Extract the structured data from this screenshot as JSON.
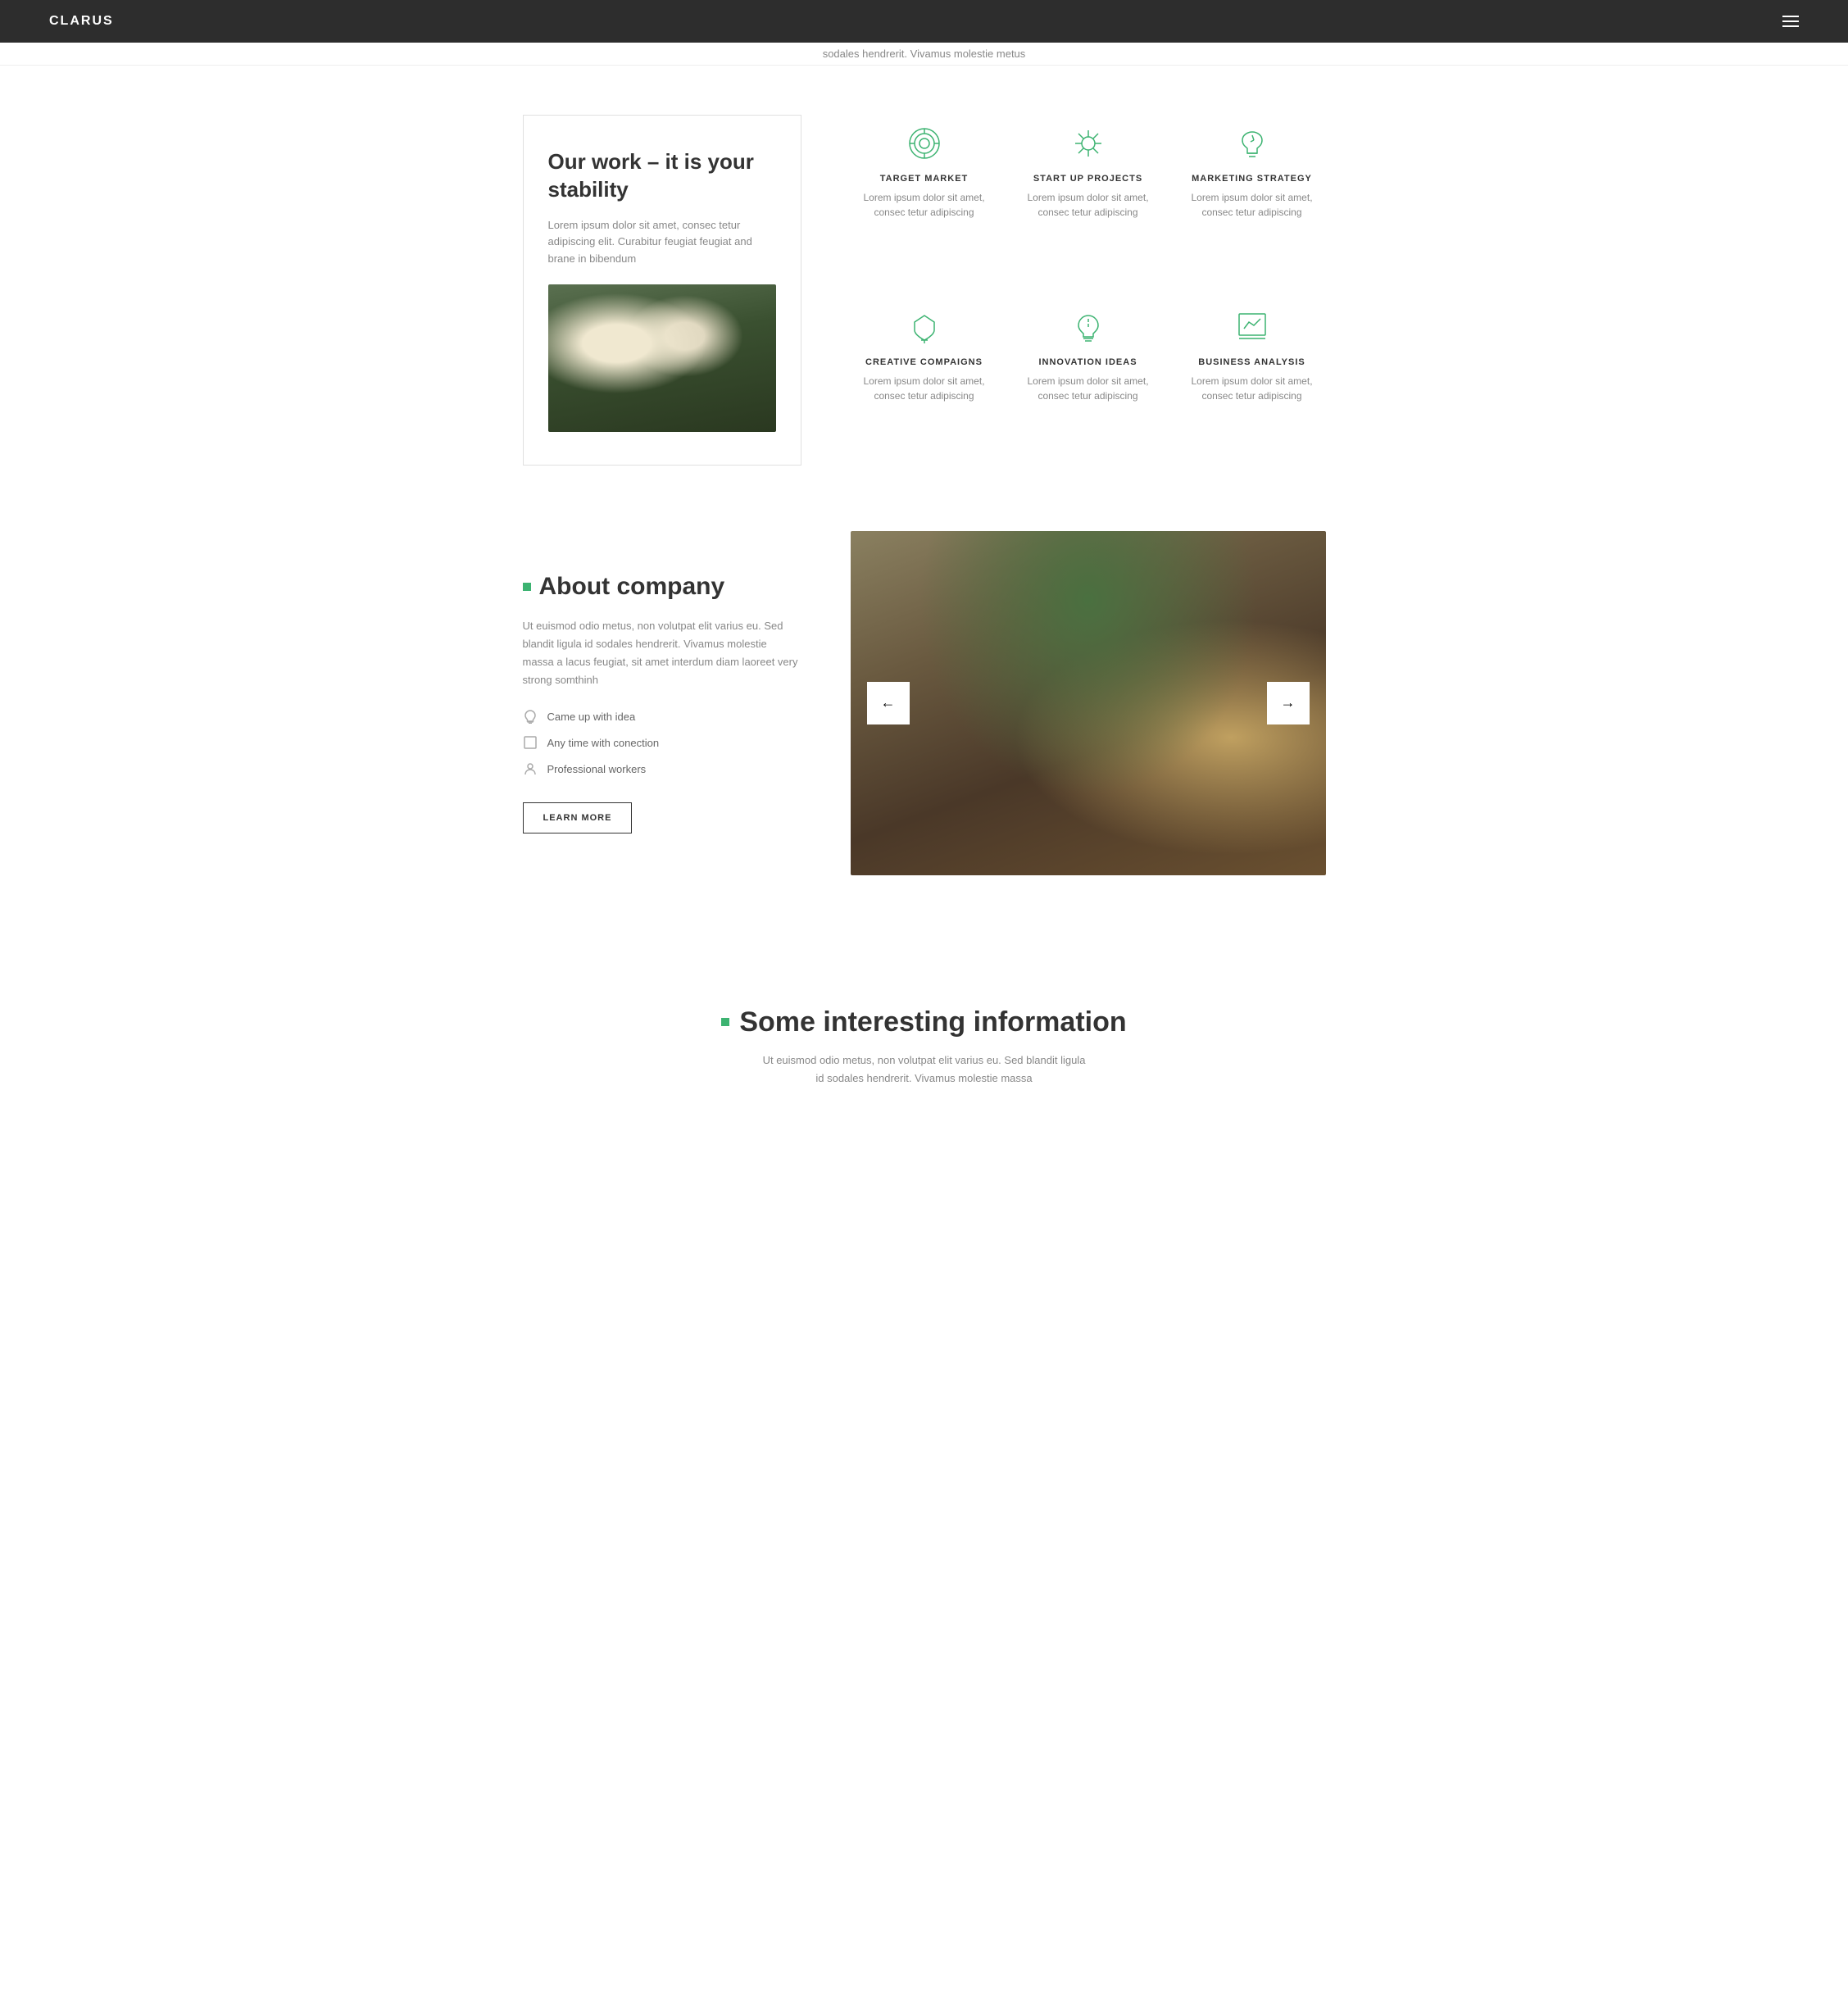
{
  "nav": {
    "logo": "CLARUS",
    "menu_icon_label": "menu"
  },
  "top_text": "sodales hendrerit. Vivamus molestie metus",
  "section_work": {
    "title": "Our work – it is your stability",
    "description": "Lorem ipsum dolor sit amet, consec tetur adipiscing elit. Curabitur feugiat feugiat and brane in bibendum",
    "features": [
      {
        "id": "target-market",
        "title": "TARGET MARKET",
        "description": "Lorem ipsum dolor sit amet, consec tetur adipiscing",
        "icon": "target"
      },
      {
        "id": "startup-projects",
        "title": "START UP PROJECTS",
        "description": "Lorem ipsum dolor sit amet, consec tetur adipiscing",
        "icon": "telescope"
      },
      {
        "id": "marketing-strategy",
        "title": "MARKETING STRATEGY",
        "description": "Lorem ipsum dolor sit amet, consec tetur adipiscing",
        "icon": "horse"
      },
      {
        "id": "creative-campaigns",
        "title": "CREATIVE COMPAIGNS",
        "description": "Lorem ipsum dolor sit amet, consec tetur adipiscing",
        "icon": "trophy"
      },
      {
        "id": "innovation-ideas",
        "title": "INNOVATION IDEAS",
        "description": "Lorem ipsum dolor sit amet, consec tetur adipiscing",
        "icon": "bulb"
      },
      {
        "id": "business-analysis",
        "title": "BUSINESS ANALYSIS",
        "description": "Lorem ipsum dolor sit amet, consec tetur adipiscing",
        "icon": "chart"
      }
    ]
  },
  "section_about": {
    "title": "About company",
    "description": "Ut euismod odio metus, non volutpat elit varius eu. Sed blandit ligula id sodales hendrerit. Vivamus molestie massa a lacus feugiat, sit amet interdum diam laoreet very strong somthinh",
    "list_items": [
      {
        "id": "idea",
        "text": "Came up with idea",
        "icon": "bulb"
      },
      {
        "id": "time",
        "text": "Any time with conection",
        "icon": "square"
      },
      {
        "id": "workers",
        "text": "Professional workers",
        "icon": "people"
      }
    ],
    "button_label": "LEARN MORE"
  },
  "section_info": {
    "title": "Some interesting information",
    "description": "Ut euismod odio metus, non volutpat elit varius eu. Sed blandit ligula id sodales hendrerit. Vivamus molestie massa"
  }
}
